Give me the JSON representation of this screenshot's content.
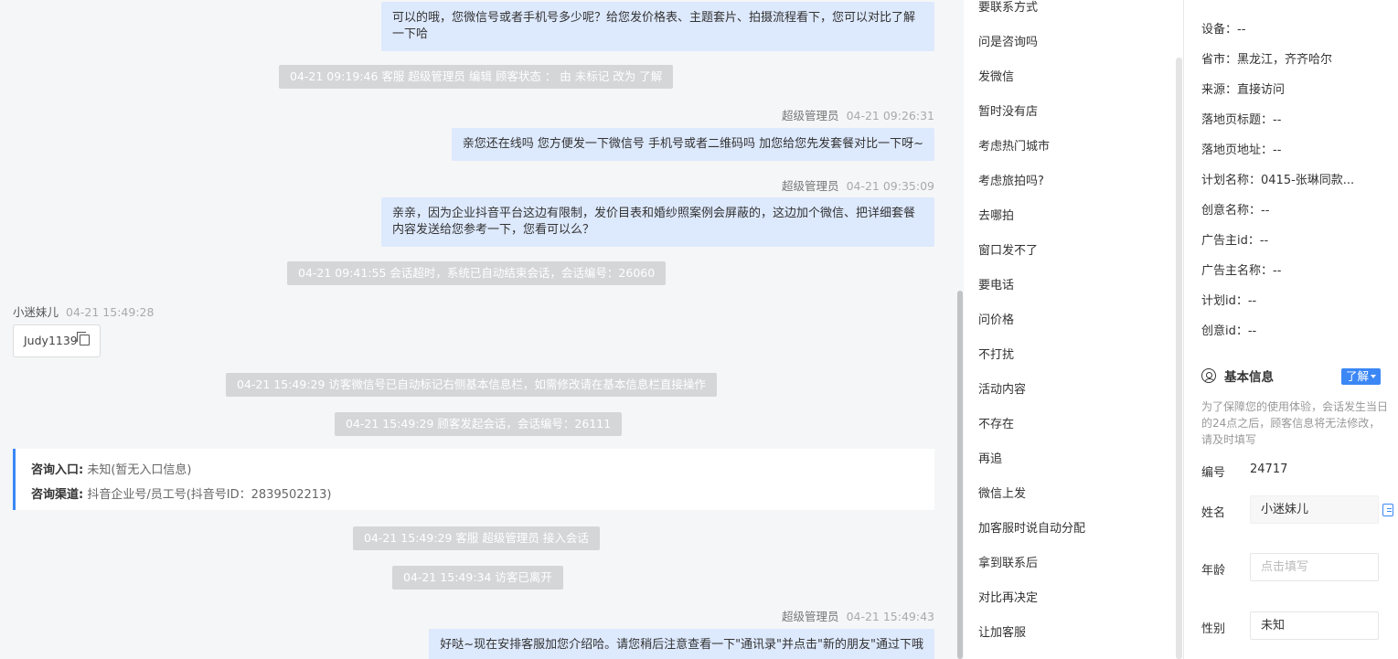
{
  "chat": {
    "messages": [
      {
        "kind": "agent",
        "text": "可以的哦，您微信号或者手机号多少呢？给您发价格表、主题套片、拍摄流程看下，您可以对比了解一下哈"
      },
      {
        "kind": "system",
        "text": "04-21 09:19:46 客服 超级管理员 编辑 顾客状态 ： 由 未标记 改为 了解"
      },
      {
        "kind": "meta",
        "name": "超级管理员",
        "time": "04-21 09:26:31"
      },
      {
        "kind": "agent",
        "text": "亲您还在线吗 您方便发一下微信号 手机号或者二维码吗 加您给您先发套餐对比一下呀~"
      },
      {
        "kind": "meta",
        "name": "超级管理员",
        "time": "04-21 09:35:09"
      },
      {
        "kind": "agent",
        "text": "亲亲，因为企业抖音平台这边有限制，发价目表和婚纱照案例会屏蔽的，这边加个微信、把详细套餐内容发送给您参考一下，您看可以么？"
      },
      {
        "kind": "system",
        "text": "04-21 09:41:55 会话超时，系统已自动结束会话，会话编号：26060"
      },
      {
        "kind": "visitor_meta",
        "name": "小迷妹儿",
        "time": "04-21 15:49:28"
      },
      {
        "kind": "wechat_chip",
        "text": "Judy1139"
      },
      {
        "kind": "system",
        "text": "04-21 15:49:29 访客微信号已自动标记右侧基本信息栏，如需修改请在基本信息栏直接操作"
      },
      {
        "kind": "system",
        "text": "04-21 15:49:29 顾客发起会话，会话编号：26111"
      },
      {
        "kind": "system",
        "text": "04-21 15:49:29 客服 超级管理员 接入会话"
      },
      {
        "kind": "system",
        "text": "04-21 15:49:34 访客已离开"
      },
      {
        "kind": "meta",
        "name": "超级管理员",
        "time": "04-21 15:49:43"
      },
      {
        "kind": "agent",
        "text": "好哒~现在安排客服加您介绍哈。请您稍后注意查看一下\"通讯录\"并点击\"新的朋友\"通过下哦"
      }
    ],
    "entry_card": {
      "entry_label": "咨询入口:",
      "entry_value": "未知(暂无入口信息)",
      "channel_label": "咨询渠道:",
      "channel_value": "抖音企业号/员工号(抖音号ID：2839502213)"
    }
  },
  "tags": [
    "要联系方式",
    "问是咨询吗",
    "发微信",
    "暂时没有店",
    "考虑热门城市",
    "考虑旅拍吗?",
    "去哪拍",
    "窗口发不了",
    "要电话",
    "问价格",
    "不打扰",
    "活动内容",
    "不存在",
    "再追",
    "微信上发",
    "加客服时说自动分配",
    "拿到联系后",
    "对比再决定",
    "让加客服"
  ],
  "info": {
    "rows": [
      "设备：--",
      "省市：黑龙江，齐齐哈尔",
      "来源：直接访问",
      "落地页标题：--",
      "落地页地址：--",
      "计划名称：0415-张琳同款...",
      "创意名称：--",
      "广告主id：--",
      "广告主名称：--",
      "计划id：--",
      "创意id：--"
    ],
    "section_title": "基本信息",
    "status_tag": "了解",
    "notice": "为了保障您的使用体验，会话发生当日的24点之后，顾客信息将无法修改，请及时填写",
    "id_label": "编号",
    "id_value": "24717",
    "name_label": "姓名",
    "name_value": "小迷妹儿",
    "age_label": "年龄",
    "age_placeholder": "点击填写",
    "gender_label": "性别",
    "gender_value": "未知"
  },
  "colors": {
    "accent": "#3b87f5",
    "bubble": "#dde9fd",
    "system_pill": "#d5d6d8"
  }
}
